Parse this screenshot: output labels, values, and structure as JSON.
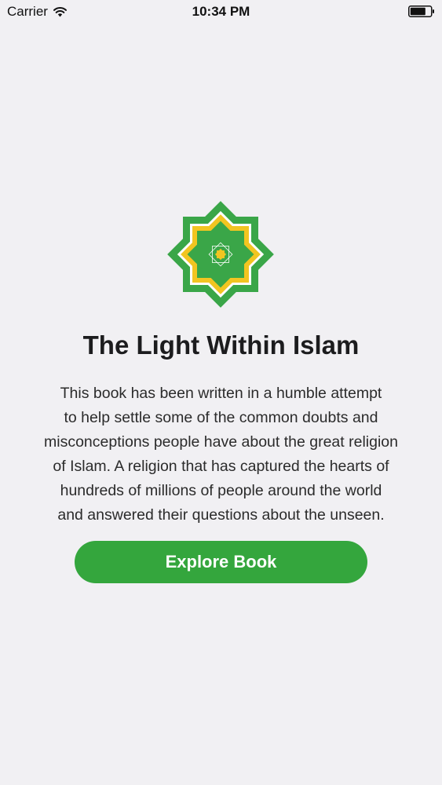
{
  "status_bar": {
    "carrier": "Carrier",
    "time": "10:34 PM",
    "wifi_icon": "wifi-icon",
    "battery_icon": "battery-icon"
  },
  "emblem": {
    "icon": "eight-point-star-icon",
    "colors": {
      "outer": "#3aa648",
      "border": "#ffffff",
      "ring": "#f2c521",
      "center": "#f2c521"
    }
  },
  "book": {
    "title": "The Light Within Islam",
    "description_lines": [
      "This book has been written in a humble attempt",
      "to help settle some of the common doubts and",
      "misconceptions people have about the great religion",
      "of Islam. A religion that has captured the hearts of",
      "hundreds of millions of people around the world",
      "and answered their questions about the unseen."
    ]
  },
  "actions": {
    "explore_label": "Explore Book"
  },
  "colors": {
    "background": "#f1f0f3",
    "accent": "#34a63d",
    "button_text": "#ffffff"
  }
}
